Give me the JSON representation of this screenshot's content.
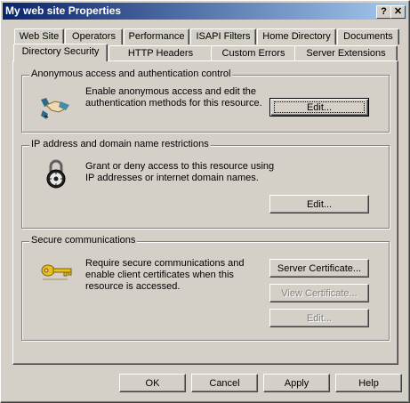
{
  "window": {
    "title": "My web site Properties",
    "help_button": "?",
    "close_button": "✕"
  },
  "tabs_row1": [
    {
      "label": "Web Site"
    },
    {
      "label": "Operators"
    },
    {
      "label": "Performance"
    },
    {
      "label": "ISAPI Filters"
    },
    {
      "label": "Home Directory"
    },
    {
      "label": "Documents"
    }
  ],
  "tabs_row2": [
    {
      "label": "Directory Security",
      "active": true
    },
    {
      "label": "HTTP Headers"
    },
    {
      "label": "Custom Errors"
    },
    {
      "label": "Server Extensions"
    }
  ],
  "anonymous": {
    "title": "Anonymous access and authentication control",
    "description_line1": "Enable anonymous access and edit the",
    "description_line2": "authentication methods for this resource.",
    "edit_button": "Edit...",
    "icon": "handshake-icon"
  },
  "ip_restrictions": {
    "title": "IP address and domain name restrictions",
    "description_line1": "Grant or deny access to this resource using",
    "description_line2": "IP addresses or internet domain names.",
    "edit_button": "Edit...",
    "icon": "padlock-icon"
  },
  "secure": {
    "title": "Secure communications",
    "description_line1": "Require secure communications and",
    "description_line2": "enable client certificates when this",
    "description_line3": "resource is accessed.",
    "server_certificate_button": "Server Certificate...",
    "view_certificate_button": "View Certificate...",
    "edit_button": "Edit...",
    "icon": "key-icon"
  },
  "footer": {
    "ok": "OK",
    "cancel": "Cancel",
    "apply": "Apply",
    "help": "Help"
  },
  "colors": {
    "face": "#d4d0c8",
    "title_start": "#0a246a",
    "title_end": "#a6caf0",
    "disabled_text": "#808080"
  }
}
